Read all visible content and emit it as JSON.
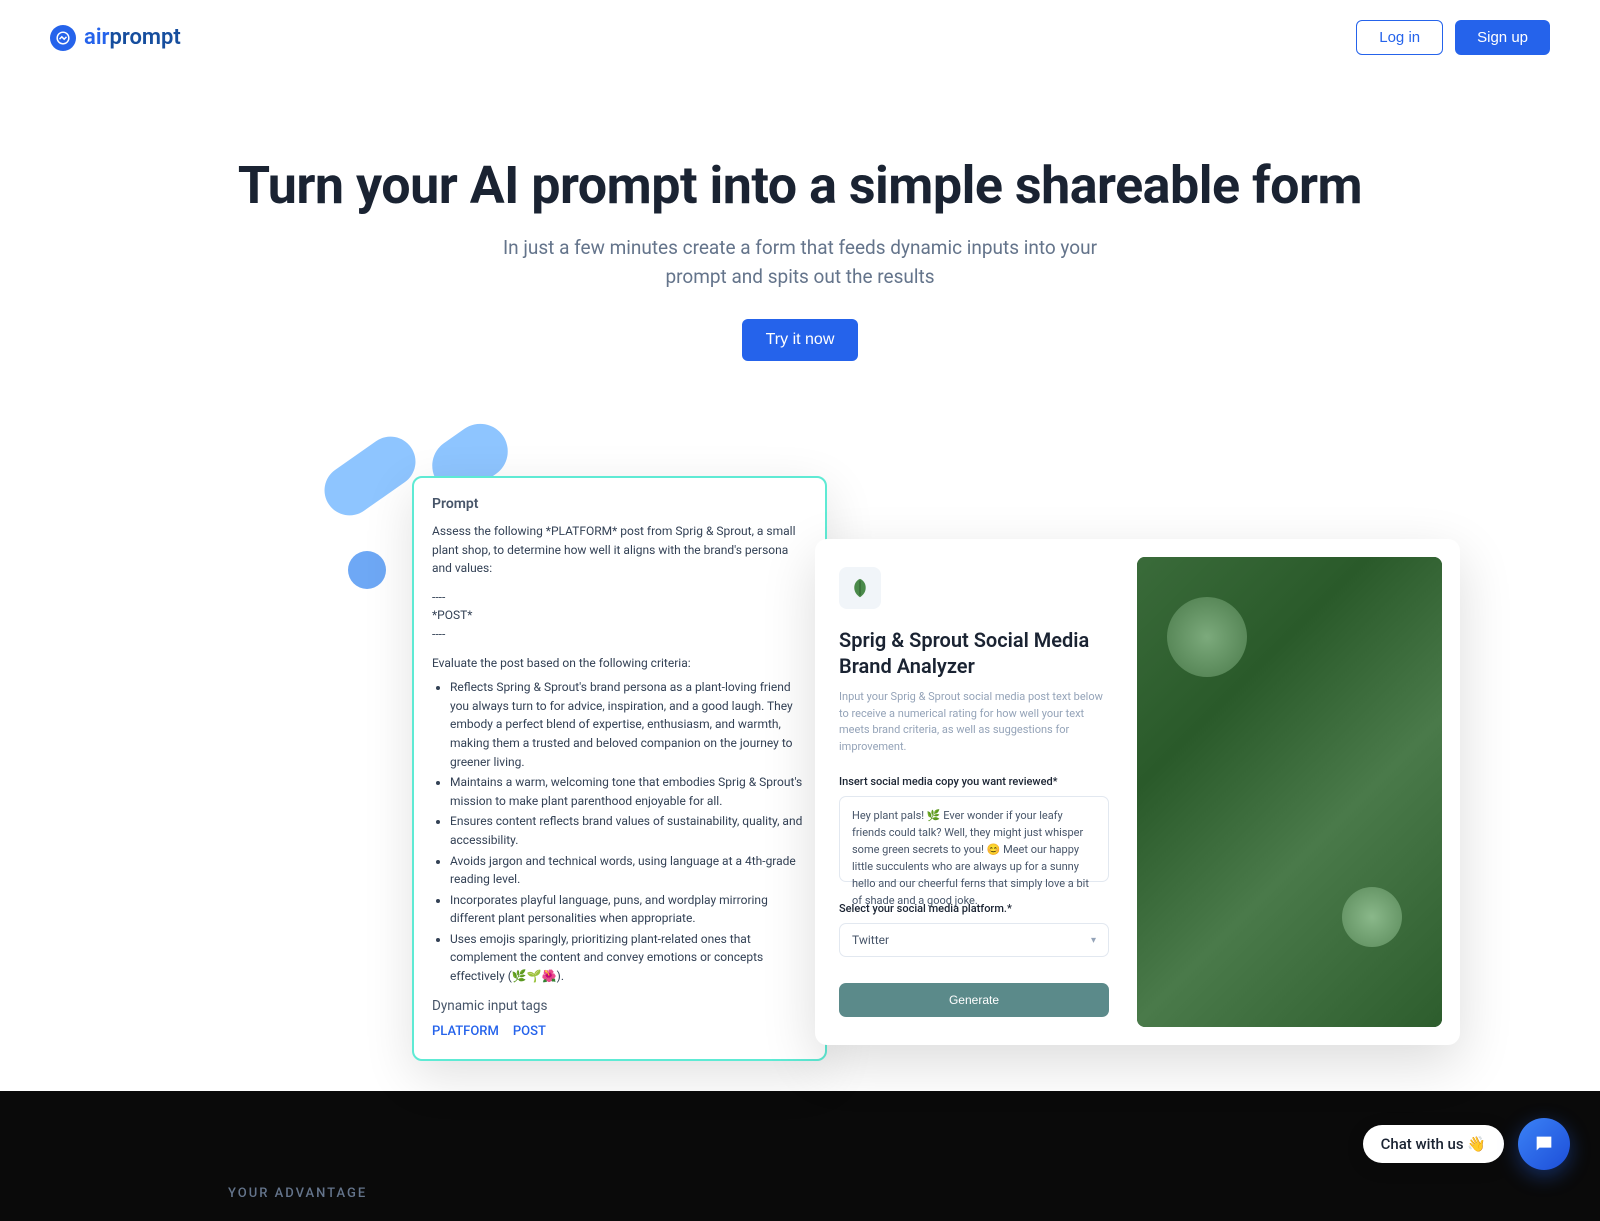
{
  "header": {
    "logo_air": "air",
    "logo_prompt": "prompt",
    "login": "Log in",
    "signup": "Sign up"
  },
  "hero": {
    "title": "Turn your AI prompt into a simple shareable form",
    "subtitle_l1": "In just a few minutes create a form that feeds dynamic inputs into your",
    "subtitle_l2": "prompt and spits out the results",
    "cta": "Try it now"
  },
  "prompt_card": {
    "heading": "Prompt",
    "intro": "Assess the following *PLATFORM* post from Sprig & Sprout, a small plant shop, to determine how well it aligns with the brand's persona and values:",
    "sep1": "----",
    "post": "*POST*",
    "sep2": "----",
    "eval_label": "Evaluate the post based on the following criteria:",
    "c1": "Reflects Spring & Sprout's brand persona as a plant-loving friend you always turn to for advice, inspiration, and a good laugh. They embody a perfect blend of expertise, enthusiasm, and warmth, making them a trusted and beloved companion on the journey to greener living.",
    "c2": "Maintains a warm, welcoming tone that embodies Sprig & Sprout's mission to make plant parenthood enjoyable for all.",
    "c3": "Ensures content reflects brand values of sustainability, quality, and accessibility.",
    "c4": "Avoids jargon and technical words, using language at a 4th-grade reading level.",
    "c5": "Incorporates playful language, puns, and wordplay mirroring different plant personalities when appropriate.",
    "c6": "Uses emojis sparingly, prioritizing plant-related ones that complement the content and convey emotions or concepts effectively (🌿🌱🌺).",
    "dit": "Dynamic input tags",
    "tag1": "PLATFORM",
    "tag2": "POST"
  },
  "form_card": {
    "title": "Sprig & Sprout Social Media Brand Analyzer",
    "desc": "Input your Sprig & Sprout social media post text below to receive a numerical rating for how well your text meets brand criteria, as well as suggestions for improvement.",
    "label1": "Insert social media copy you want reviewed*",
    "sample": "Hey plant pals! 🌿 Ever wonder if your leafy friends could talk? Well, they might just whisper some green secrets to you! 😊 Meet our happy little succulents who are always up for a sunny hello and our cheerful ferns that simply love a bit of shade and a good joke.",
    "label2": "Select your social media platform.*",
    "select_value": "Twitter",
    "button": "Generate"
  },
  "advantage": "YOUR ADVANTAGE",
  "chat": "Chat with us 👋"
}
